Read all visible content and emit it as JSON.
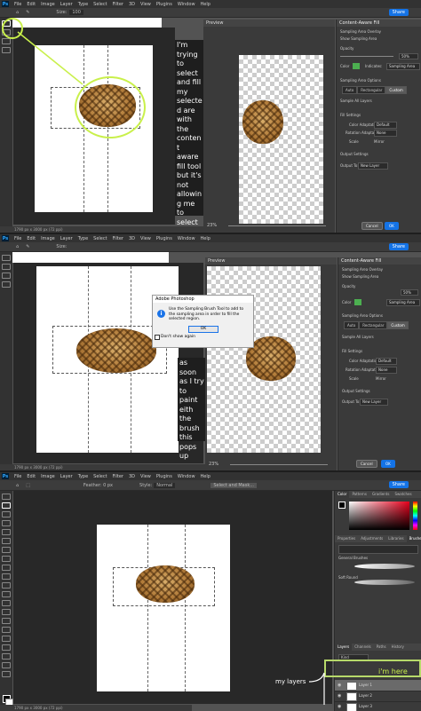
{
  "app": {
    "menu": [
      "File",
      "Edit",
      "Image",
      "Layer",
      "Type",
      "Select",
      "Filter",
      "3D",
      "View",
      "Plugins",
      "Window",
      "Help"
    ],
    "ps_label": "Ps",
    "share_label": "Share"
  },
  "shot1": {
    "options": {
      "size_label": "Size:",
      "size_value": "100"
    },
    "preview_title": "Preview",
    "panel": {
      "title": "Content-Aware Fill",
      "overlay_section": "Sampling Area Overlay",
      "show_sampling": "Show Sampling Area",
      "opacity_label": "Opacity",
      "opacity_value": "50%",
      "color_label": "Color",
      "indicates_label": "Indicates:",
      "indicates_value": "Sampling Area",
      "options_section": "Sampling Area Options",
      "auto": "Auto",
      "rect": "Rectangular",
      "custom": "Custom",
      "sample_all": "Sample All Layers",
      "fill_section": "Fill Settings",
      "color_adapt_label": "Color Adaptation",
      "color_adapt_value": "Default",
      "rotation_label": "Rotation Adaptation",
      "rotation_value": "None",
      "scale_label": "Scale",
      "mirror_label": "Mirror",
      "output_section": "Output Settings",
      "output_label": "Output To:",
      "output_value": "New Layer",
      "cancel": "Cancel",
      "ok": "OK"
    },
    "zoom": "23%",
    "status": "1790 px x 3000 px (72 ppi)",
    "note": "I'm trying to select and fill my selected are with the content aware fill tool but it's not allowing me to select the area"
  },
  "shot2": {
    "dialog": {
      "title": "Adobe Photoshop",
      "message": "Use the Sampling Brush Tool to add to the sampling area in order to fill the selected region.",
      "ok": "OK",
      "dont_show": "Don't show again"
    },
    "note": "as soon as I try to paint eith the brush this pops up"
  },
  "shot3": {
    "options": {
      "feather": "Feather: 0 px",
      "style": "Style:",
      "style_value": "Normal",
      "select_mask": "Select and Mask..."
    },
    "color_tabs": [
      "Color",
      "Patterns",
      "Gradients",
      "Swatches"
    ],
    "mid_tabs": [
      "Properties",
      "Adjustments",
      "Libraries",
      "Brushes"
    ],
    "brush_size": "General Brushes",
    "brush_name": "Soft Round",
    "layer_tabs": [
      "Layers",
      "Channels",
      "Paths",
      "History"
    ],
    "kind": "Kind",
    "layers": [
      "Layer 1",
      "Layer 2",
      "Layer 3"
    ],
    "annotation_im_here": "i'm here",
    "annotation_my_layers": "my layers",
    "status": "1790 px x 3000 px (72 ppi)"
  },
  "colors": {
    "accent": "#c9f04b",
    "blue": "#1473e6",
    "layer_highlight": "#b7d96a"
  }
}
